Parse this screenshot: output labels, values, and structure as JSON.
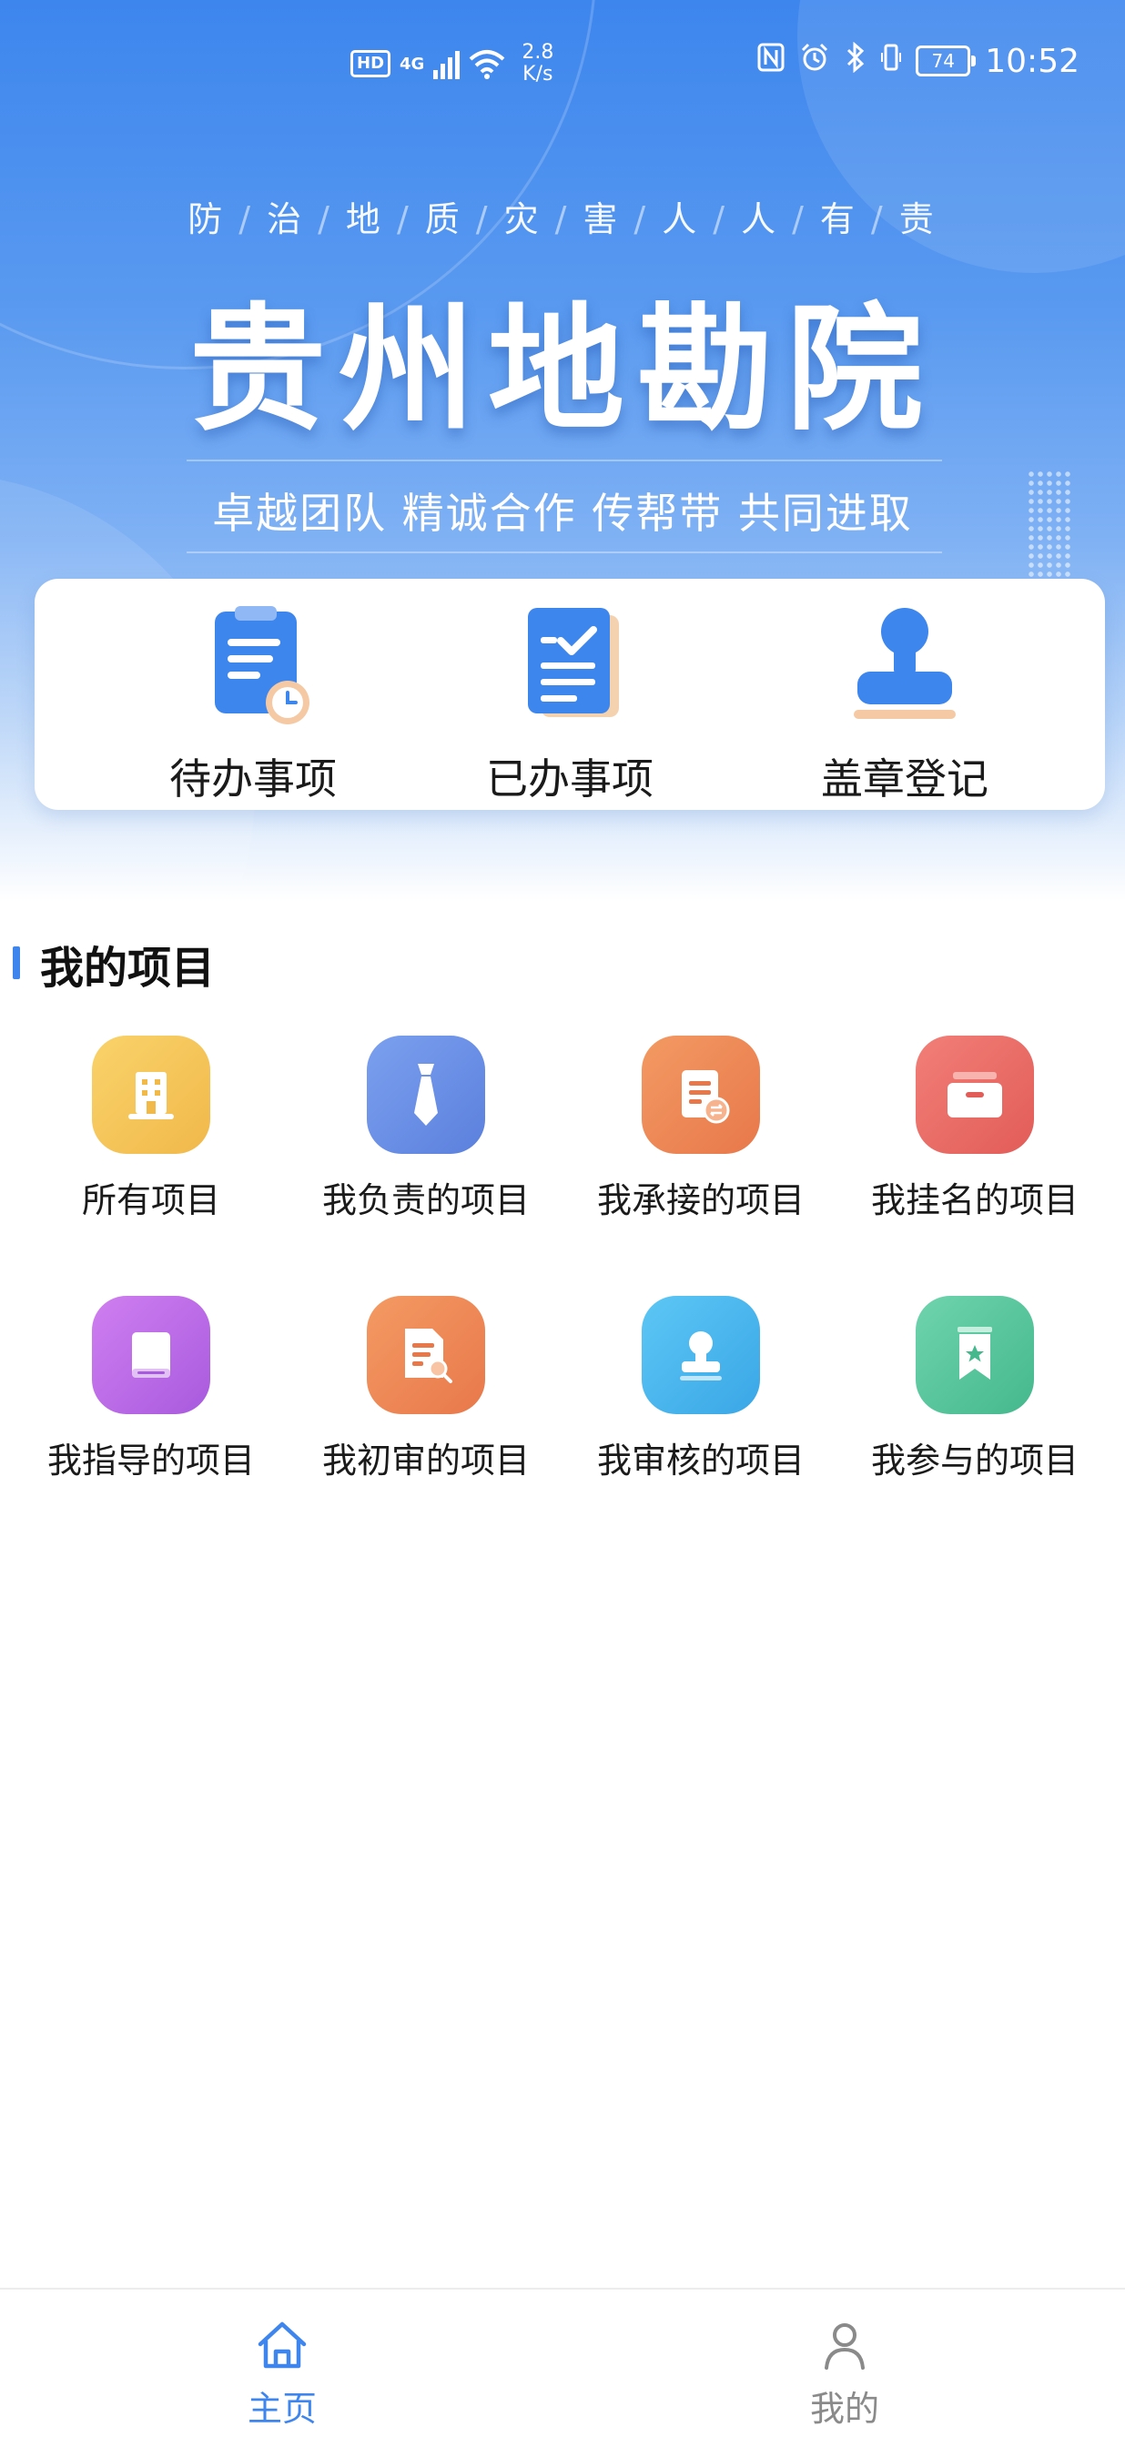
{
  "status_bar": {
    "hd": "HD",
    "network": "4G",
    "speed_value": "2.8",
    "speed_unit": "K/s",
    "battery": "74",
    "time": "10:52"
  },
  "banner": {
    "slogan_chars": [
      "防",
      "治",
      "地",
      "质",
      "灾",
      "害",
      "人",
      "人",
      "有",
      "责"
    ],
    "title": "贵州地勘院",
    "motto": "卓越团队 精诚合作 传帮带 共同进取"
  },
  "quick_actions": [
    {
      "label": "待办事项",
      "icon": "clipboard-clock-icon"
    },
    {
      "label": "已办事项",
      "icon": "checked-document-icon"
    },
    {
      "label": "盖章登记",
      "icon": "stamp-icon"
    }
  ],
  "section": {
    "title": "我的项目"
  },
  "projects": [
    {
      "label": "所有项目",
      "icon": "building-icon",
      "color": "#f5c65a"
    },
    {
      "label": "我负责的项目",
      "icon": "tie-icon",
      "color": "#6a8fe6"
    },
    {
      "label": "我承接的项目",
      "icon": "document-exchange-icon",
      "color": "#ef8a57"
    },
    {
      "label": "我挂名的项目",
      "icon": "inbox-icon",
      "color": "#ee6f6a"
    },
    {
      "label": "我指导的项目",
      "icon": "book-icon",
      "color": "#c06ee9"
    },
    {
      "label": "我初审的项目",
      "icon": "document-search-icon",
      "color": "#f08a58"
    },
    {
      "label": "我审核的项目",
      "icon": "person-stamp-icon",
      "color": "#4cb8ef"
    },
    {
      "label": "我参与的项目",
      "icon": "bookmark-star-icon",
      "color": "#5dc9a2"
    }
  ],
  "tabs": [
    {
      "label": "主页",
      "icon": "home-icon",
      "active": true,
      "color": "#3e86ee"
    },
    {
      "label": "我的",
      "icon": "person-icon",
      "active": false,
      "color": "#8a8a8a"
    }
  ]
}
